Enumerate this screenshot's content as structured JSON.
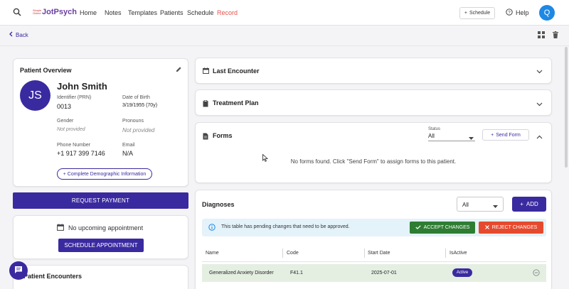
{
  "topbar": {
    "logo_small": "Simple Online",
    "logo_name": "JotPsych",
    "nav": [
      "Home",
      "Notes",
      "Templates",
      "Patients",
      "Schedule",
      "Record"
    ],
    "schedule_button": "Schedule",
    "help": "Help",
    "user_initial": "Q"
  },
  "toolbar": {
    "back": "Back"
  },
  "patient": {
    "section_title": "Patient Overview",
    "initials": "JS",
    "name": "John Smith",
    "identifier_label": "Identifier (PRN)",
    "identifier": "0013",
    "dob_label": "Date of Birth",
    "dob": "3/19/1955 (70y)",
    "gender_label": "Gender",
    "gender": "Not provided",
    "pronouns_label": "Pronouns",
    "pronouns": "Not provided",
    "phone_label": "Phone Number",
    "phone": "+1 917 399 7146",
    "email_label": "Email",
    "email": "N/A",
    "demographic_button": "+ Complete Demographic Information"
  },
  "request_payment": "REQUEST PAYMENT",
  "appointment": {
    "status": "No upcoming appointment",
    "button": "SCHEDULE APPOINTMENT"
  },
  "patient_encounters_title": "Patient Encounters",
  "panels": {
    "last_encounter": "Last Encounter",
    "treatment_plan": "Treatment Plan",
    "forms": "Forms"
  },
  "forms": {
    "status_label": "Status",
    "status_value": "All",
    "send_button": "Send Form",
    "empty_message": "No forms found. Click \"Send Form\" to assign forms to this patient."
  },
  "diagnoses": {
    "title": "Diagnoses",
    "filter_value": "All",
    "add_button": "ADD",
    "pending_message": "This table has pending changes that need to be approved.",
    "accept_button": "ACCEPT CHANGES",
    "reject_button": "REJECT CHANGES",
    "columns": [
      "Name",
      "Code",
      "Start Date",
      "IsActive"
    ],
    "rows": [
      {
        "name": "Generalized Anxiety Disorder",
        "code": "F41.1",
        "start_date": "2025-07-01",
        "status": "Active"
      }
    ]
  },
  "colors": {
    "primary": "#3a2aa0",
    "accept": "#2e7d32",
    "reject": "#e64a2e",
    "record": "#e5534b",
    "info_bg": "#e4f2fa",
    "pending_row": "#e4efe1",
    "avatar": "#1e88e5"
  }
}
